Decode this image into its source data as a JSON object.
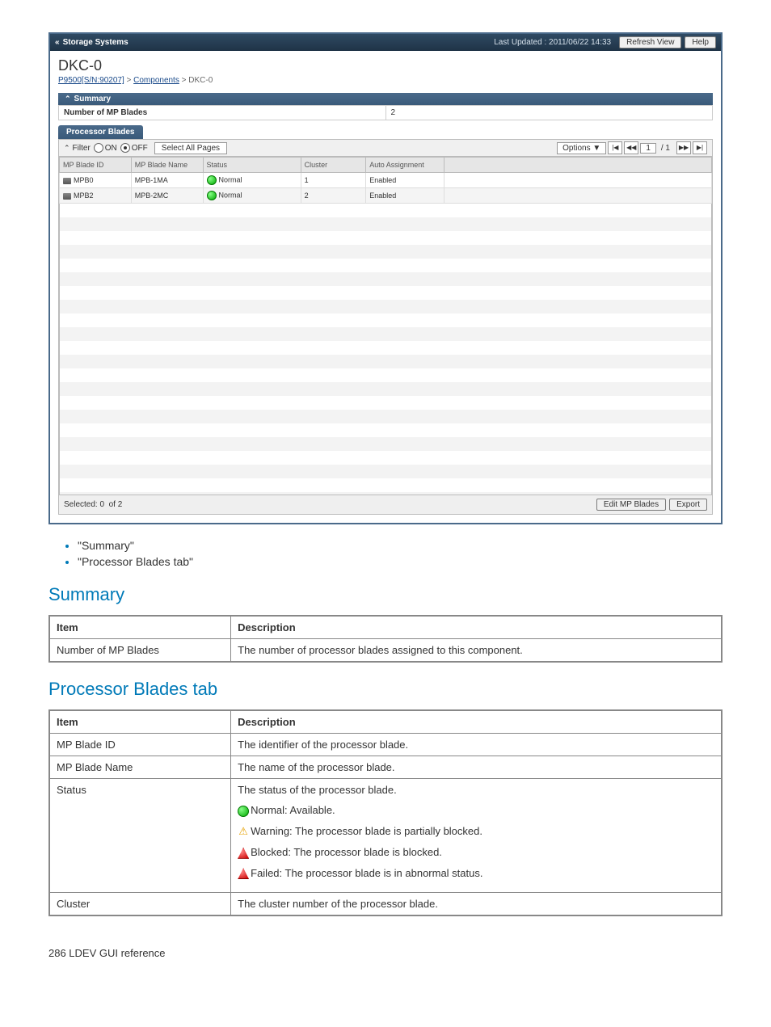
{
  "app": {
    "title": "Storage Systems",
    "last_updated_label": "Last Updated : 2011/06/22 14:33",
    "refresh_btn": "Refresh View",
    "help_btn": "Help"
  },
  "page": {
    "heading": "DKC-0",
    "crumb1": "P9500[S/N:90207]",
    "crumb2": "Components",
    "crumb3": "DKC-0"
  },
  "summary_panel": {
    "title": "Summary",
    "row_label": "Number of MP Blades",
    "row_value": "2"
  },
  "tab": {
    "label": "Processor Blades"
  },
  "toolbar": {
    "filter_label": "Filter",
    "on_label": "ON",
    "off_label": "OFF",
    "select_all": "Select All Pages",
    "options": "Options",
    "page_current": "1",
    "page_total": "/ 1"
  },
  "grid": {
    "headers": [
      "MP Blade ID",
      "MP Blade Name",
      "Status",
      "Cluster",
      "Auto Assignment"
    ],
    "rows": [
      {
        "id": "MPB0",
        "name": "MPB-1MA",
        "status": "Normal",
        "cluster": "1",
        "auto": "Enabled"
      },
      {
        "id": "MPB2",
        "name": "MPB-2MC",
        "status": "Normal",
        "cluster": "2",
        "auto": "Enabled"
      }
    ]
  },
  "status_bar": {
    "selected_label": "Selected:",
    "selected_count": "0",
    "of_label": "of",
    "total": "2",
    "edit_btn": "Edit MP Blades",
    "export_btn": "Export"
  },
  "doc": {
    "links": [
      "\"Summary\"",
      "\"Processor Blades tab\""
    ],
    "summary_heading": "Summary",
    "pb_heading": "Processor Blades tab",
    "th_item": "Item",
    "th_desc": "Description",
    "summary_table": [
      {
        "item": "Number of MP Blades",
        "desc": "The number of processor blades assigned to this component."
      }
    ],
    "pb_table": {
      "row0": {
        "item": "MP Blade ID",
        "desc": "The identifier of the processor blade."
      },
      "row1": {
        "item": "MP Blade Name",
        "desc": "The name of the processor blade."
      },
      "row2": {
        "item": "Status",
        "desc_line": "The status of the processor blade.",
        "normal": "Normal: Available.",
        "warning": "Warning: The processor blade is partially blocked.",
        "blocked": "Blocked: The processor blade is blocked.",
        "failed": "Failed: The processor blade is in abnormal status."
      },
      "row3": {
        "item": "Cluster",
        "desc": "The cluster number of the processor blade."
      }
    },
    "footer": "286  LDEV GUI reference"
  }
}
